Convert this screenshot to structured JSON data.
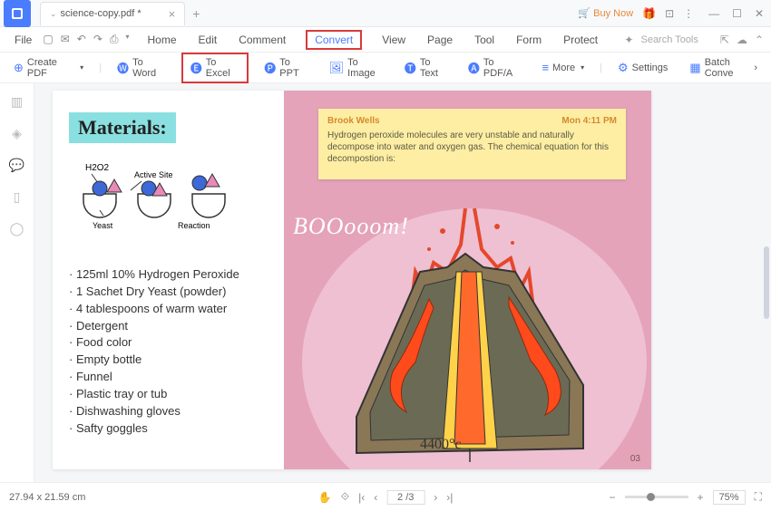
{
  "titlebar": {
    "tab_name": "science-copy.pdf *",
    "buy_now": "Buy Now"
  },
  "menubar": {
    "file": "File",
    "tabs": [
      "Home",
      "Edit",
      "Comment",
      "Convert",
      "View",
      "Page",
      "Tool",
      "Form",
      "Protect"
    ],
    "search_placeholder": "Search Tools"
  },
  "toolbar": {
    "create_pdf": "Create PDF",
    "to_word": "To Word",
    "to_excel": "To Excel",
    "to_ppt": "To PPT",
    "to_image": "To Image",
    "to_text": "To Text",
    "to_pdfa": "To PDF/A",
    "more": "More",
    "settings": "Settings",
    "batch": "Batch Conve"
  },
  "document": {
    "materials_title": "Materials:",
    "diagram_labels": {
      "h2o2": "H2O2",
      "active_site": "Active Site",
      "yeast": "Yeast",
      "reaction": "Reaction"
    },
    "materials_list": [
      "125ml 10% Hydrogen Peroxide",
      "1 Sachet Dry Yeast (powder)",
      "4 tablespoons of warm water",
      "Detergent",
      "Food color",
      "Empty bottle",
      "Funnel",
      "Plastic tray or tub",
      "Dishwashing gloves",
      "Safty goggles"
    ],
    "note": {
      "author": "Brook Wells",
      "time": "Mon 4:11 PM",
      "body": "Hydrogen peroxide molecules are very unstable and naturally decompose into water and oxygen gas. The chemical equation for this decompostion is:"
    },
    "boom": "BOOooom!",
    "temp": "4400°c",
    "page_num": "03"
  },
  "status": {
    "dimensions": "27.94 x 21.59 cm",
    "page_indicator": "2 /3",
    "zoom": "75%"
  }
}
